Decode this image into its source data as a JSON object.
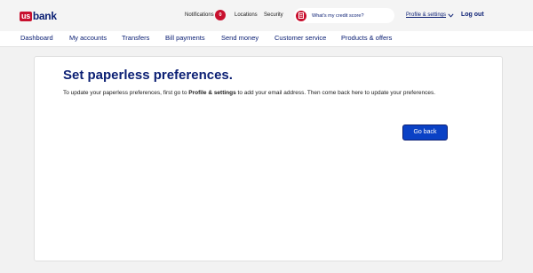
{
  "header": {
    "logo_us": "us",
    "logo_bank": "bank",
    "notifications_label": "Notifications",
    "notifications_count": "0",
    "locations_label": "Locations",
    "security_label": "Security",
    "credit_score_text": "What's my credit score?",
    "credit_icon": "credit-score-icon",
    "profile_label": "Profile & settings",
    "profile_icon": "chevron-down-icon",
    "logout_label": "Log out"
  },
  "nav": {
    "items": [
      "Dashboard",
      "My accounts",
      "Transfers",
      "Bill payments",
      "Send money",
      "Customer service",
      "Products & offers"
    ]
  },
  "main": {
    "title": "Set paperless preferences.",
    "desc_before": "To update your paperless preferences, first go to ",
    "desc_bold": "Profile & settings",
    "desc_after": " to add your email address. Then come back here to update your preferences.",
    "button_label": "Go back"
  },
  "colors": {
    "brand_red": "#c8102e",
    "brand_navy": "#0c2074",
    "button_blue": "#0a41c5"
  }
}
